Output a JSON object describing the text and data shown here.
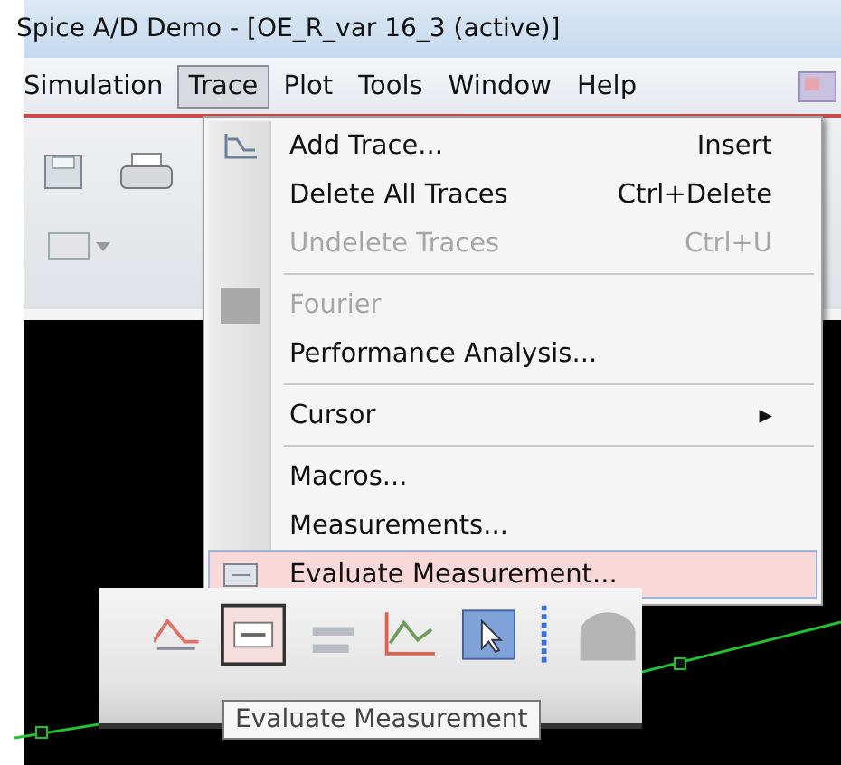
{
  "window": {
    "title": "Spice A/D Demo  - [OE_R_var  16_3 (active)]"
  },
  "menu_bar": [
    {
      "label": "Simulation",
      "selected": false
    },
    {
      "label": "Trace",
      "selected": true
    },
    {
      "label": "Plot",
      "selected": false
    },
    {
      "label": "Tools",
      "selected": false
    },
    {
      "label": "Window",
      "selected": false
    },
    {
      "label": "Help",
      "selected": false
    }
  ],
  "menu": {
    "items": [
      {
        "kind": "item",
        "label": "Add Trace...",
        "shortcut": "Insert",
        "disabled": false,
        "selected": false,
        "icon": true
      },
      {
        "kind": "item",
        "label": "Delete All Traces",
        "shortcut": "Ctrl+Delete",
        "disabled": false,
        "selected": false,
        "icon": false
      },
      {
        "kind": "item",
        "label": "Undelete Traces",
        "shortcut": "Ctrl+U",
        "disabled": true,
        "selected": false,
        "icon": false
      },
      {
        "kind": "separator"
      },
      {
        "kind": "item",
        "label": "Fourier",
        "disabled": true,
        "selected": false,
        "icon": true
      },
      {
        "kind": "item",
        "label": "Performance Analysis...",
        "disabled": false,
        "selected": false,
        "icon": false
      },
      {
        "kind": "separator"
      },
      {
        "kind": "submenu",
        "label": "Cursor",
        "arrow": "▸",
        "disabled": false,
        "selected": false,
        "icon": false
      },
      {
        "kind": "separator"
      },
      {
        "kind": "item",
        "label": "Macros...",
        "disabled": false,
        "selected": false,
        "icon": false
      },
      {
        "kind": "item",
        "label": "Measurements...",
        "disabled": false,
        "selected": false,
        "icon": false
      },
      {
        "kind": "item",
        "label": "Evaluate Measurement...",
        "disabled": false,
        "selected": true,
        "icon": true
      }
    ]
  },
  "tooltip": {
    "text": "Evaluate Measurement"
  }
}
